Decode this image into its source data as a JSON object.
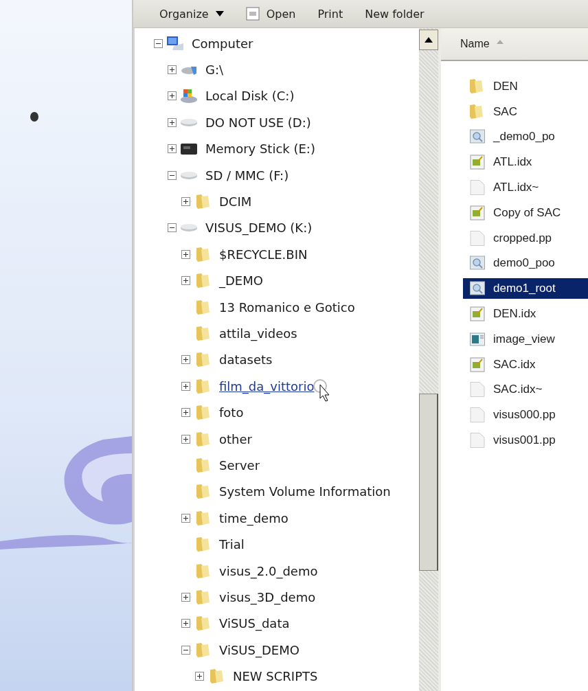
{
  "toolbar": {
    "items": [
      {
        "label": "Organize",
        "kind": "menu"
      },
      {
        "label": "Open",
        "kind": "icon-button"
      },
      {
        "label": "Print",
        "kind": "button"
      },
      {
        "label": "New folder",
        "kind": "button"
      }
    ]
  },
  "tree": [
    {
      "label": "Computer",
      "kind": "computer",
      "expandable": true,
      "expanded": true,
      "hovered": false,
      "children": [
        {
          "label": "G:\\",
          "kind": "usb-drive",
          "expandable": true,
          "expanded": false,
          "hovered": false
        },
        {
          "label": "Local Disk (C:)",
          "kind": "system-drive",
          "expandable": true,
          "expanded": false,
          "hovered": false
        },
        {
          "label": "DO NOT USE (D:)",
          "kind": "drive",
          "expandable": true,
          "expanded": false,
          "hovered": false
        },
        {
          "label": "Memory Stick (E:)",
          "kind": "card",
          "expandable": true,
          "expanded": false,
          "hovered": false
        },
        {
          "label": "SD / MMC (F:)",
          "kind": "drive",
          "expandable": true,
          "expanded": true,
          "hovered": false,
          "children": [
            {
              "label": "DCIM",
              "kind": "folder",
              "expandable": true,
              "expanded": false,
              "hovered": false
            }
          ]
        },
        {
          "label": "VISUS_DEMO (K:)",
          "kind": "drive",
          "expandable": true,
          "expanded": true,
          "hovered": false,
          "children": [
            {
              "label": "$RECYCLE.BIN",
              "kind": "folder",
              "expandable": true,
              "expanded": false,
              "hovered": false
            },
            {
              "label": "_DEMO",
              "kind": "folder",
              "expandable": true,
              "expanded": false,
              "hovered": false
            },
            {
              "label": "13 Romanico e Gotico",
              "kind": "folder",
              "expandable": false,
              "hovered": false
            },
            {
              "label": "attila_videos",
              "kind": "folder",
              "expandable": false,
              "hovered": false
            },
            {
              "label": "datasets",
              "kind": "folder",
              "expandable": true,
              "expanded": false,
              "hovered": false
            },
            {
              "label": "film_da_vittorio",
              "kind": "folder",
              "expandable": true,
              "expanded": false,
              "hovered": true
            },
            {
              "label": "foto",
              "kind": "folder",
              "expandable": true,
              "expanded": false,
              "hovered": false
            },
            {
              "label": "other",
              "kind": "folder",
              "expandable": true,
              "expanded": false,
              "hovered": false
            },
            {
              "label": "Server",
              "kind": "folder",
              "expandable": false,
              "hovered": false
            },
            {
              "label": "System Volume Information",
              "kind": "folder",
              "expandable": false,
              "hovered": false
            },
            {
              "label": "time_demo",
              "kind": "folder",
              "expandable": true,
              "expanded": false,
              "hovered": false
            },
            {
              "label": "Trial",
              "kind": "folder",
              "expandable": false,
              "hovered": false
            },
            {
              "label": "visus_2.0_demo",
              "kind": "folder",
              "expandable": false,
              "hovered": false
            },
            {
              "label": "visus_3D_demo",
              "kind": "folder",
              "expandable": true,
              "expanded": false,
              "hovered": false
            },
            {
              "label": "ViSUS_data",
              "kind": "folder",
              "expandable": true,
              "expanded": false,
              "hovered": false
            },
            {
              "label": "ViSUS_DEMO",
              "kind": "folder",
              "expandable": true,
              "expanded": true,
              "hovered": false,
              "children": [
                {
                  "label": "NEW SCRIPTS",
                  "kind": "folder",
                  "expandable": true,
                  "expanded": false,
                  "hovered": false
                }
              ]
            }
          ]
        }
      ]
    }
  ],
  "files": {
    "column": "Name",
    "sort_ascending": true,
    "rows": [
      {
        "name": "DEN",
        "kind": "folder",
        "selected": false
      },
      {
        "name": "SAC",
        "kind": "folder",
        "selected": false
      },
      {
        "name": "_demo0_po",
        "kind": "magnifier",
        "selected": false
      },
      {
        "name": "ATL.idx",
        "kind": "note",
        "selected": false
      },
      {
        "name": "ATL.idx~",
        "kind": "blank",
        "selected": false
      },
      {
        "name": "Copy of SAC",
        "kind": "note",
        "selected": false
      },
      {
        "name": "cropped.pp",
        "kind": "blank",
        "selected": false
      },
      {
        "name": "demo0_poo",
        "kind": "magnifier",
        "selected": false
      },
      {
        "name": "demo1_root",
        "kind": "magnifier",
        "selected": true
      },
      {
        "name": "DEN.idx",
        "kind": "note",
        "selected": false
      },
      {
        "name": "image_view",
        "kind": "app",
        "selected": false
      },
      {
        "name": "SAC.idx",
        "kind": "note",
        "selected": false
      },
      {
        "name": "SAC.idx~",
        "kind": "blank",
        "selected": false
      },
      {
        "name": "visus000.pp",
        "kind": "blank",
        "selected": false
      },
      {
        "name": "visus001.pp",
        "kind": "blank",
        "selected": false
      }
    ]
  }
}
